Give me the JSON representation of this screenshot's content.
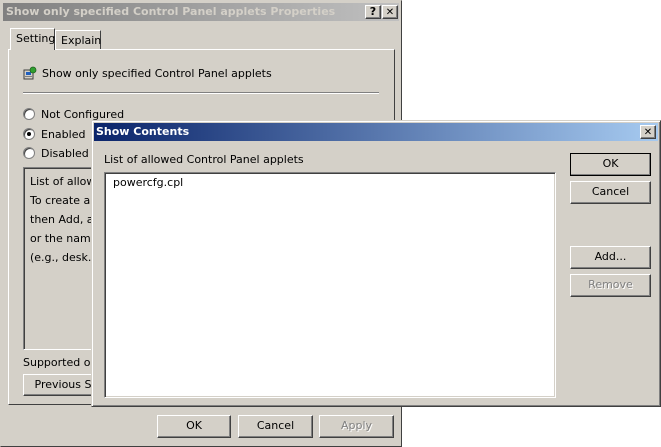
{
  "props_dialog": {
    "title": "Show only specified Control Panel applets Properties",
    "help_button": "?",
    "close_button": "✕",
    "tabs": [
      "Setting",
      "Explain"
    ],
    "policy_name": "Show only specified Control Panel applets",
    "radios": [
      {
        "label": "Not Configured",
        "checked": false
      },
      {
        "label": "Enabled",
        "checked": true
      },
      {
        "label": "Disabled",
        "checked": false
      }
    ],
    "description_lines": [
      "List of allowe",
      "To create a li",
      "then Add, an",
      "or the name o",
      "(e.g., desk.cp"
    ],
    "supported_label": "Supported on:",
    "previous_button": "Previous S",
    "buttons": {
      "ok": "OK",
      "cancel": "Cancel",
      "apply": "Apply"
    }
  },
  "show_contents": {
    "title": "Show Contents",
    "close_button": "✕",
    "list_label": "List of allowed Control Panel applets",
    "items": [
      "powercfg.cpl"
    ],
    "buttons": {
      "ok": "OK",
      "cancel": "Cancel",
      "add": "Add...",
      "remove": "Remove"
    }
  },
  "colors": {
    "face": "#d4d0c8",
    "active_title_start": "#0a246a",
    "active_title_end": "#a6caf0",
    "inactive_title_start": "#808080",
    "inactive_title_end": "#c0c0c0"
  }
}
